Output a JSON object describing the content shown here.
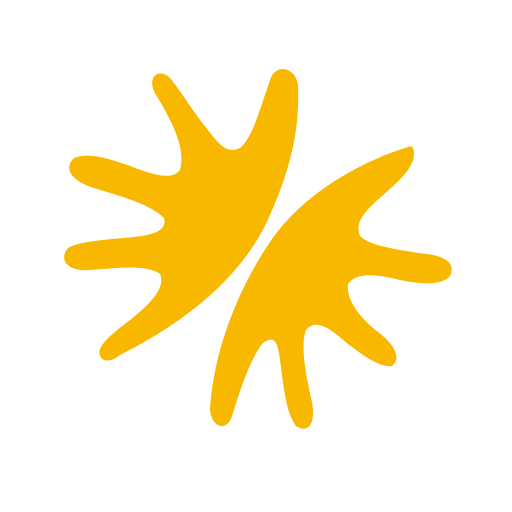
{
  "logo": {
    "icon_name": "two-hands-emblem-icon",
    "fill_color": "#F9B800",
    "background_color": "#FFFFFF"
  }
}
